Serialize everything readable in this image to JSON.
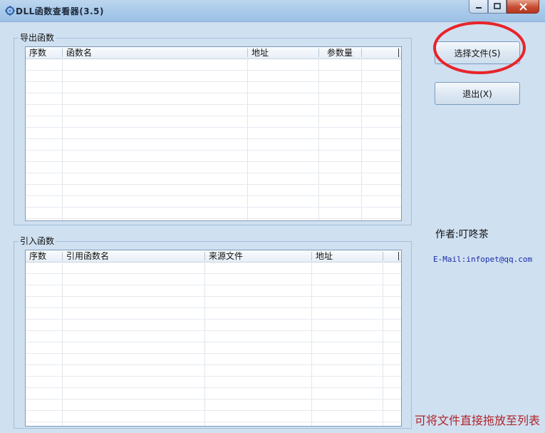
{
  "window": {
    "title": "DLL函数查看器(3.5)"
  },
  "export_group": {
    "label": "导出函数",
    "columns": [
      "序数",
      "函数名",
      "地址",
      "参数量"
    ],
    "rows": []
  },
  "import_group": {
    "label": "引入函数",
    "columns": [
      "序数",
      "引用函数名",
      "来源文件",
      "地址"
    ],
    "rows": []
  },
  "buttons": {
    "select_file": "选择文件(S)",
    "exit": "退出(X)"
  },
  "info": {
    "author": "作者:叮咚茶",
    "email": "E-Mail:infopet@qq.com",
    "drag_hint": "可将文件直接拖放至列表"
  },
  "colors": {
    "highlight": "#e8242a",
    "hint_text": "#b0242a",
    "email_text": "#1a2aa8"
  }
}
